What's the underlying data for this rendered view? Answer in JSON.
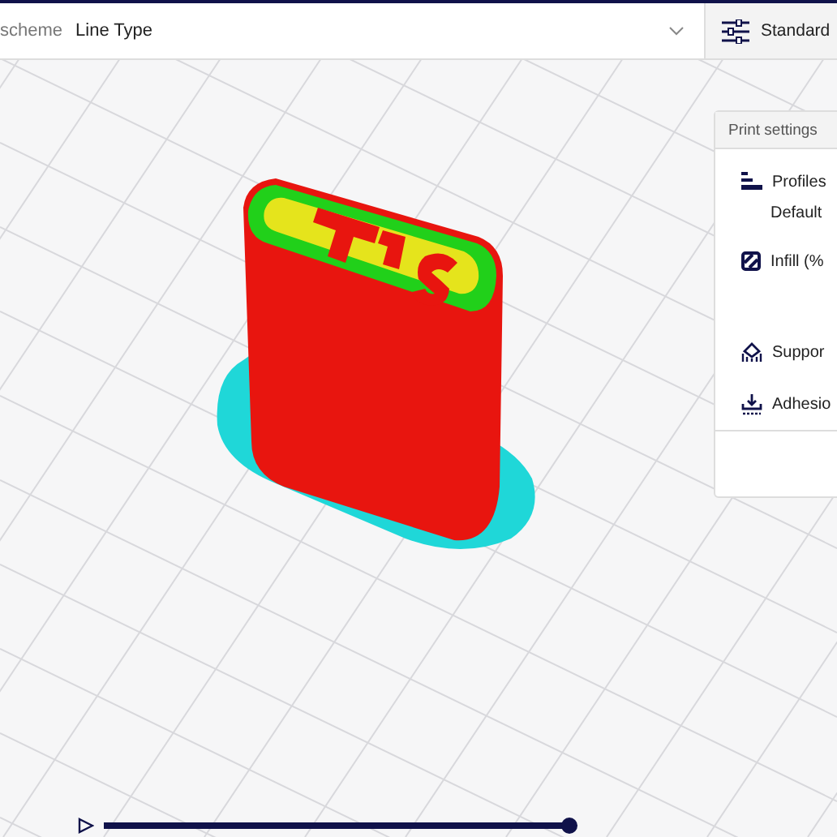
{
  "view_bar": {
    "color_scheme_label": "scheme",
    "color_scheme_value": "Line Type"
  },
  "print_setup_button": {
    "label": "Standard"
  },
  "print_settings": {
    "title": "Print settings",
    "items": [
      {
        "kind": "profiles",
        "label": "Profiles"
      },
      {
        "kind": "profile_value",
        "label": "Default"
      },
      {
        "kind": "infill",
        "label": "Infill (%"
      },
      {
        "kind": "support",
        "label": "Suppor"
      },
      {
        "kind": "adhesion",
        "label": "Adhesio"
      }
    ]
  },
  "layer_slider": {
    "level": 1
  }
}
